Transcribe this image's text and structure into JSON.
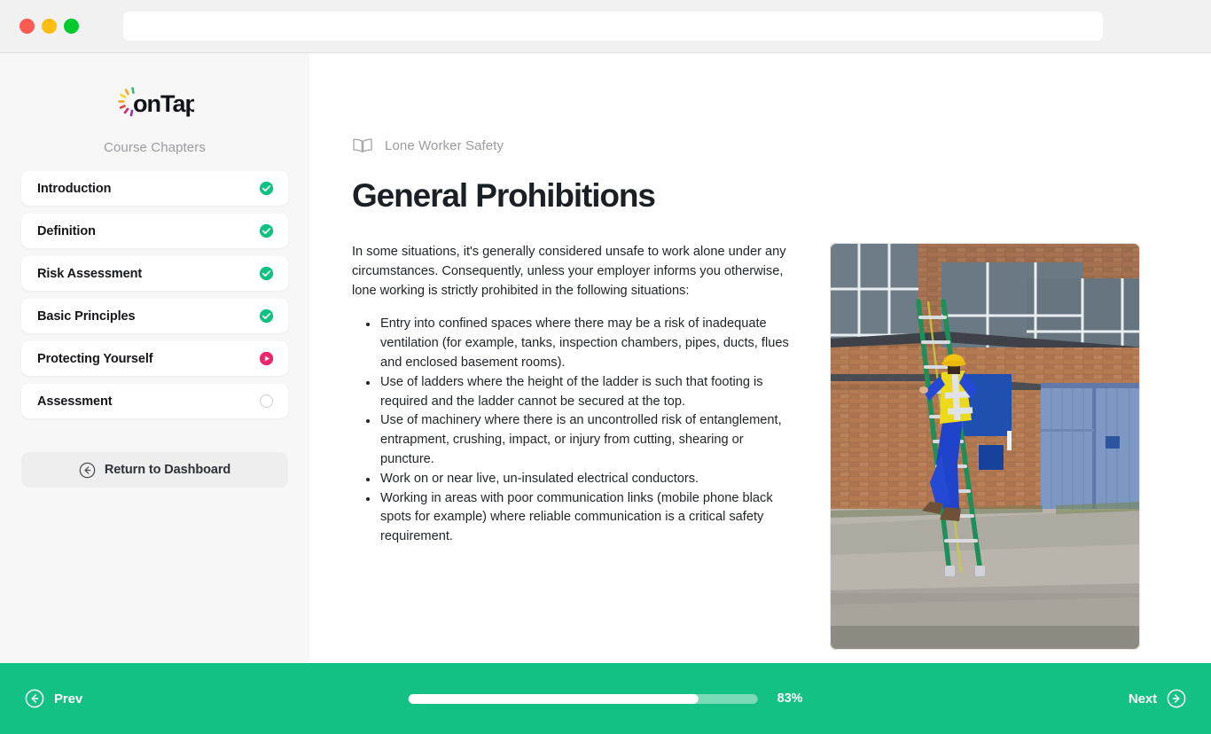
{
  "window": {
    "traffic_lights": [
      "close",
      "minimize",
      "maximize"
    ],
    "address_value": "",
    "address_placeholder": ""
  },
  "sidebar": {
    "logo_text": "onTap",
    "section_title": "Course Chapters",
    "chapters": [
      {
        "label": "Introduction",
        "status": "complete"
      },
      {
        "label": "Definition",
        "status": "complete"
      },
      {
        "label": "Risk Assessment",
        "status": "complete"
      },
      {
        "label": "Basic Principles",
        "status": "complete"
      },
      {
        "label": "Protecting Yourself",
        "status": "current"
      },
      {
        "label": "Assessment",
        "status": "locked"
      }
    ],
    "return_button": "Return to Dashboard"
  },
  "main": {
    "breadcrumb": "Lone Worker Safety",
    "breadcrumb_icon": "book-icon",
    "title": "General Prohibitions",
    "intro": "In some situations, it's generally considered unsafe to work alone under any circumstances.  Consequently, unless your employer informs you otherwise, lone working is strictly prohibited in the following situations:",
    "prohibitions": [
      "Entry into confined spaces where there may be a risk of inadequate ventilation (for example, tanks, inspection chambers, pipes, ducts, flues and enclosed basement rooms).",
      "Use of ladders where the height of the ladder is such that footing is required and the ladder cannot be secured at the top.",
      "Use of machinery where there is an uncontrolled risk of entanglement, entrapment, crushing, impact, or injury from cutting, shearing or puncture.",
      "Work on or near live, un-insulated electrical conductors.",
      "Working in areas with poor communication links (mobile phone black spots for example) where reliable communication is a critical safety requirement."
    ],
    "image_alt": "Worker in hi-vis vest and hard hat climbing a ladder against a brick industrial building"
  },
  "footer": {
    "prev_label": "Prev",
    "next_label": "Next",
    "progress_percent": 83,
    "progress_label": "83%"
  },
  "colors": {
    "accent_green": "#14c184",
    "progress_track": "#7adcb7",
    "status_complete": "#0fc281",
    "status_current": "#f0246e",
    "status_locked": "#d4d6dd",
    "sidebar_bg": "#f7f7f7",
    "chrome_bg": "#f1f1f1",
    "text_dark": "#1b1f26",
    "text_muted": "#9b9ba1"
  }
}
